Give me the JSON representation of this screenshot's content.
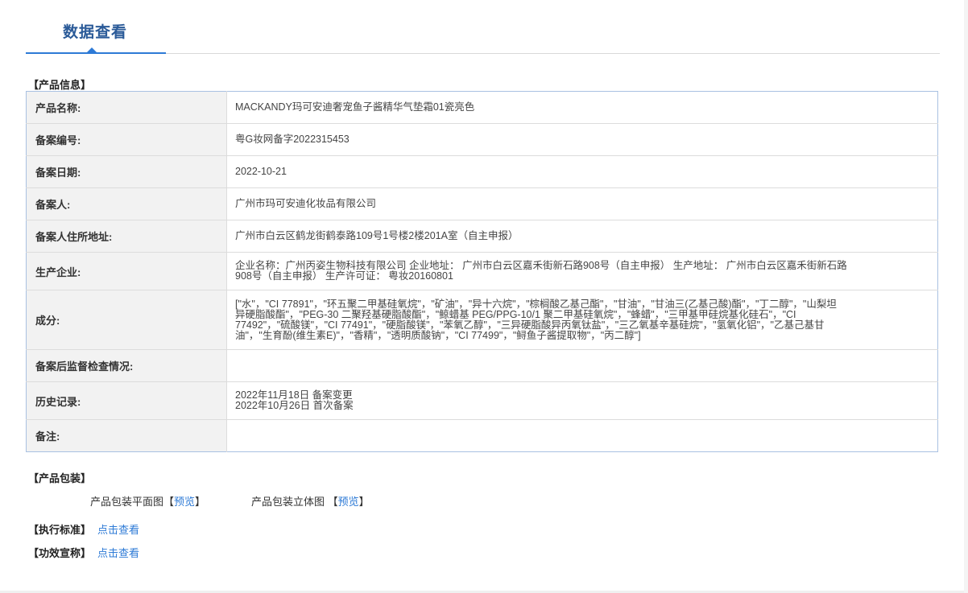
{
  "tab": {
    "title": "数据查看"
  },
  "product_info": {
    "heading": "【产品信息】",
    "rows": [
      {
        "label": "产品名称:",
        "lines": [
          "MACKANDY玛可安迪奢宠鱼子酱精华气垫霜01瓷亮色"
        ]
      },
      {
        "label": "备案编号:",
        "lines": [
          "粤G妆网备字2022315453"
        ]
      },
      {
        "label": "备案日期:",
        "lines": [
          "2022-10-21"
        ]
      },
      {
        "label": "备案人:",
        "lines": [
          "广州市玛可安迪化妆品有限公司"
        ]
      },
      {
        "label": "备案人住所地址:",
        "lines": [
          "广州市白云区鹤龙街鹤泰路109号1号楼2楼201A室（自主申报）"
        ]
      },
      {
        "label": "生产企业:",
        "lines": [
          "企业名称：广州丙姿生物科技有限公司 企业地址： 广州市白云区嘉禾街新石路908号（自主申报） 生产地址： 广州市白云区嘉禾街新石路",
          "908号（自主申报） 生产许可证： 粤妆20160801"
        ]
      },
      {
        "label": "成分:",
        "lines": [
          "[\"水\"，\"CI 77891\"，\"环五聚二甲基硅氧烷\"，\"矿油\"，\"异十六烷\"，\"棕榈酸乙基己酯\"，\"甘油\"，\"甘油三(乙基己酸)酯\"，\"丁二醇\"，\"山梨坦",
          "异硬脂酸酯\"，\"PEG-30 二聚羟基硬脂酸酯\"，\"鲸蜡基 PEG/PPG-10/1 聚二甲基硅氧烷\"，\"蜂蜡\"，\"三甲基甲硅烷基化硅石\"，\"CI",
          "77492\"，\"硫酸镁\"，\"CI 77491\"，\"硬脂酸镁\"，\"苯氧乙醇\"，\"三异硬脂酸异丙氧钛盐\"，\"三乙氧基辛基硅烷\"，\"氢氧化铝\"，\"乙基己基甘",
          "油\"，\"生育酚(维生素E)\"，\"香精\"，\"透明质酸钠\"，\"CI 77499\"，\"鲟鱼子酱提取物\"，\"丙二醇\"]"
        ]
      },
      {
        "label": "备案后监督检查情况:",
        "lines": []
      },
      {
        "label": "历史记录:",
        "lines": [
          "2022年11月18日 备案变更",
          "2022年10月26日 首次备案"
        ]
      },
      {
        "label": "备注:",
        "lines": []
      }
    ]
  },
  "packaging": {
    "heading": "【产品包装】",
    "flat_label": "产品包装平面图",
    "solid_label": "产品包装立体图",
    "bracket_open": "【",
    "bracket_close": "】",
    "preview_label": "预览"
  },
  "standard": {
    "heading": "【执行标准】",
    "link": "点击查看"
  },
  "efficacy": {
    "heading": "【功效宣称】",
    "link": "点击查看"
  }
}
